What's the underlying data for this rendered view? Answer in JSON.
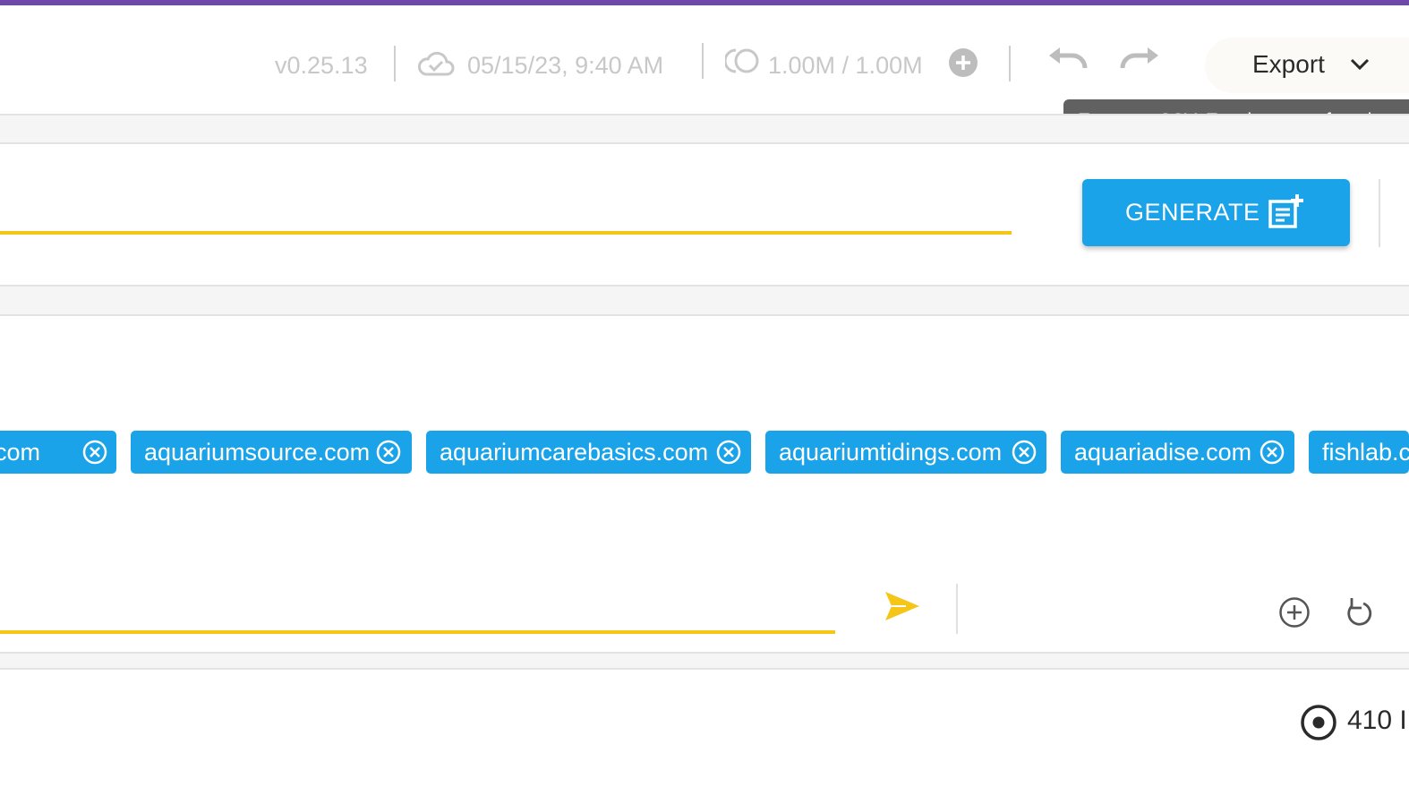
{
  "colors": {
    "accent_purple": "#6e4aa8",
    "primary_blue": "#1aa3e8",
    "highlight_yellow": "#f5c518",
    "tooltip_gray": "#616161"
  },
  "toolbar": {
    "version": "v0.25.13",
    "saved_time": "05/15/23, 9:40 AM",
    "usage": "1.00M / 1.00M",
    "icons": {
      "cloud": "cloud-icon",
      "credits": "credits-icon",
      "add_credits": "plus-circle-icon",
      "undo": "undo-icon",
      "redo": "redo-icon",
      "dropdown": "chevron-down-icon"
    },
    "export_label": "Export",
    "export_tooltip": "Export to CSV, Excel, or your favorite"
  },
  "generate": {
    "label": "GENERATE",
    "icon": "note-add-icon"
  },
  "chips": [
    {
      "label": "ef.com"
    },
    {
      "label": "aquariumsource.com"
    },
    {
      "label": "aquariumcarebasics.com"
    },
    {
      "label": "aquariumtidings.com"
    },
    {
      "label": "aquariadise.com"
    },
    {
      "label": "fishlab.c"
    }
  ],
  "input_actions": {
    "send": "send-icon",
    "add": "add-circle-icon",
    "refresh": "refresh-icon"
  },
  "status": {
    "value": "410 I",
    "icon": "radio-target-icon"
  }
}
